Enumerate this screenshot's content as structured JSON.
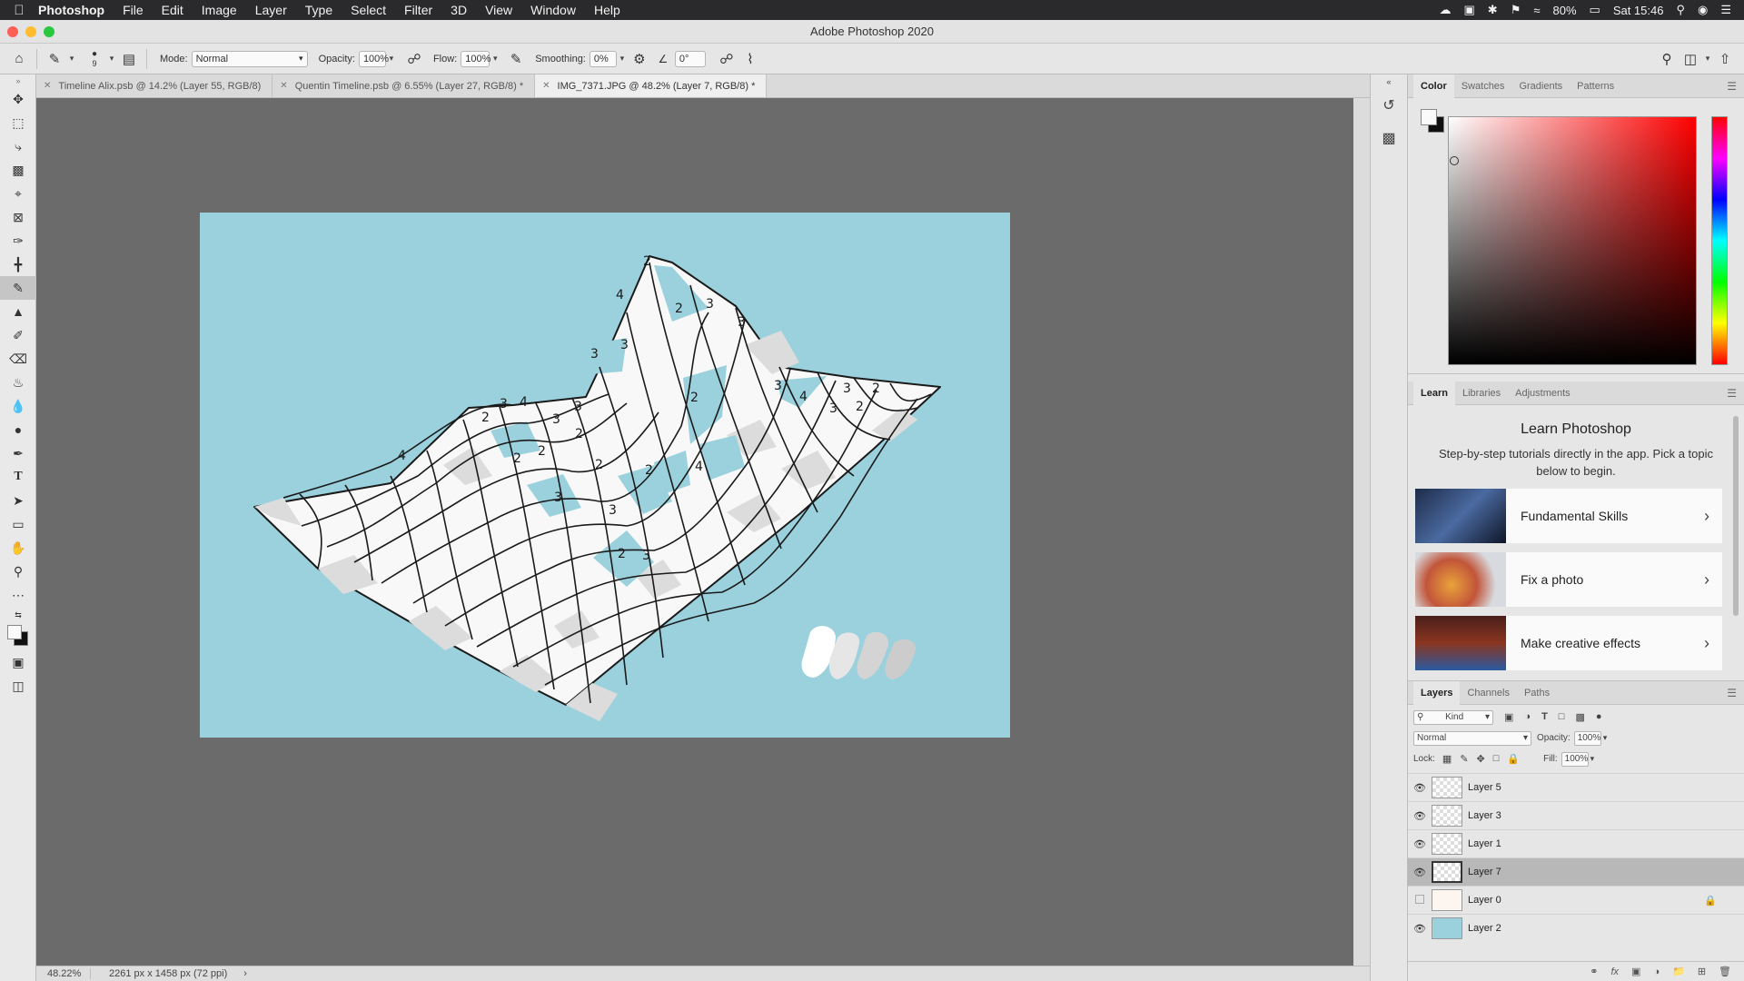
{
  "menubar": {
    "app_name": "Photoshop",
    "items": [
      "File",
      "Edit",
      "Image",
      "Layer",
      "Type",
      "Select",
      "Filter",
      "3D",
      "View",
      "Window",
      "Help"
    ],
    "battery": "80%",
    "clock": "Sat 15:46"
  },
  "window": {
    "title": "Adobe Photoshop 2020"
  },
  "options": {
    "brush_size": "9",
    "mode_label": "Mode:",
    "mode_value": "Normal",
    "opacity_label": "Opacity:",
    "opacity_value": "100%",
    "flow_label": "Flow:",
    "flow_value": "100%",
    "smoothing_label": "Smoothing:",
    "smoothing_value": "0%",
    "angle_value": "0°"
  },
  "doc_tabs": [
    {
      "label": "Timeline Alix.psb @ 14.2% (Layer 55, RGB/8)"
    },
    {
      "label": "Quentin Timeline.psb @ 6.55% (Layer 27, RGB/8) *"
    },
    {
      "label": "IMG_7371.JPG @ 48.2% (Layer 7, RGB/8) *"
    }
  ],
  "canvas": {
    "grid_numbers": [
      "2",
      "3",
      "3",
      "2",
      "3",
      "3",
      "4",
      "2",
      "3",
      "3",
      "2",
      "2",
      "3",
      "4",
      "3",
      "2",
      "2",
      "2",
      "2",
      "3",
      "3",
      "2",
      "2",
      "3",
      "4",
      "4",
      "3",
      "3",
      "2",
      "4"
    ]
  },
  "status": {
    "zoom": "48.22%",
    "doc_info": "2261 px x 1458 px (72 ppi)"
  },
  "color_panel": {
    "tabs": [
      "Color",
      "Swatches",
      "Gradients",
      "Patterns"
    ]
  },
  "learn_panel": {
    "tabs": [
      "Learn",
      "Libraries",
      "Adjustments"
    ],
    "title": "Learn Photoshop",
    "description": "Step-by-step tutorials directly in the app. Pick a topic below to begin.",
    "cards": [
      {
        "label": "Fundamental Skills"
      },
      {
        "label": "Fix a photo"
      },
      {
        "label": "Make creative effects"
      }
    ]
  },
  "layers_panel": {
    "tabs": [
      "Layers",
      "Channels",
      "Paths"
    ],
    "filter_label": "Kind",
    "blend_mode": "Normal",
    "opacity_label": "Opacity:",
    "opacity_value": "100%",
    "lock_label": "Lock:",
    "fill_label": "Fill:",
    "fill_value": "100%",
    "layers": [
      {
        "name": "Layer 5"
      },
      {
        "name": "Layer 3"
      },
      {
        "name": "Layer 1"
      },
      {
        "name": "Layer 7"
      },
      {
        "name": "Layer 0"
      },
      {
        "name": "Layer 2"
      }
    ]
  },
  "colors": {
    "canvas_bg": "#9ad1dd",
    "workspace": "#6b6b6b",
    "panel": "#e6e6e6",
    "selected_layer": "#b8b8b8"
  }
}
